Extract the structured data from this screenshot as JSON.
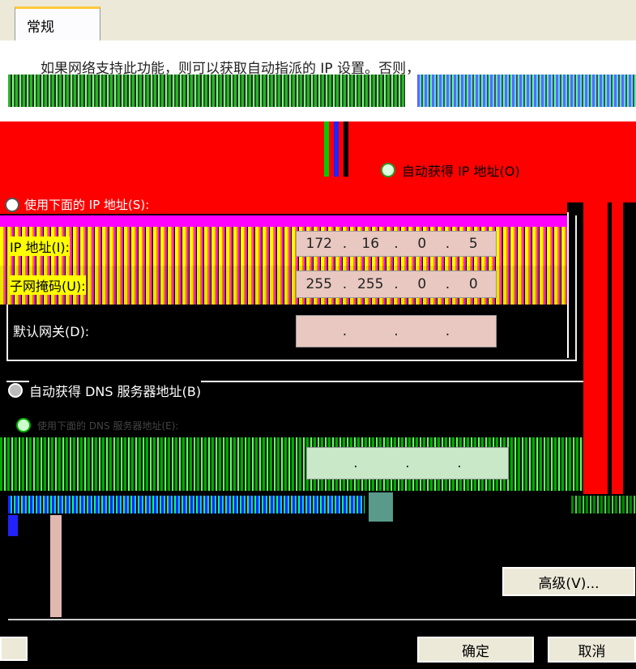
{
  "tabs": [
    {
      "label": "常规"
    }
  ],
  "intro_text": "如果网络支持此功能，则可以获取自动指派的 IP 设置。否则，",
  "ip": {
    "auto_label": "自动获得 IP 地址(O)",
    "manual_label": "使用下面的 IP 地址(S):",
    "address_label": "IP 地址(I):",
    "address": [
      "172",
      "16",
      "0",
      "5"
    ],
    "mask_label": "子网掩码(U):",
    "mask": [
      "255",
      "255",
      "0",
      "0"
    ],
    "gateway_label": "默认网关(D):",
    "gateway": [
      "",
      "",
      "",
      ""
    ]
  },
  "dns": {
    "auto_label": "自动获得 DNS 服务器地址(B)",
    "manual_label": "使用下面的 DNS 服务器地址(E):",
    "preferred": [
      "",
      "",
      "",
      ""
    ]
  },
  "buttons": {
    "advanced": "高级(V)...",
    "ok": "确定",
    "cancel": "取消"
  },
  "colors": {
    "tab_bg": "#ece9d8",
    "field_pink": "#e8c8c0",
    "field_green": "#c8e8c8"
  }
}
